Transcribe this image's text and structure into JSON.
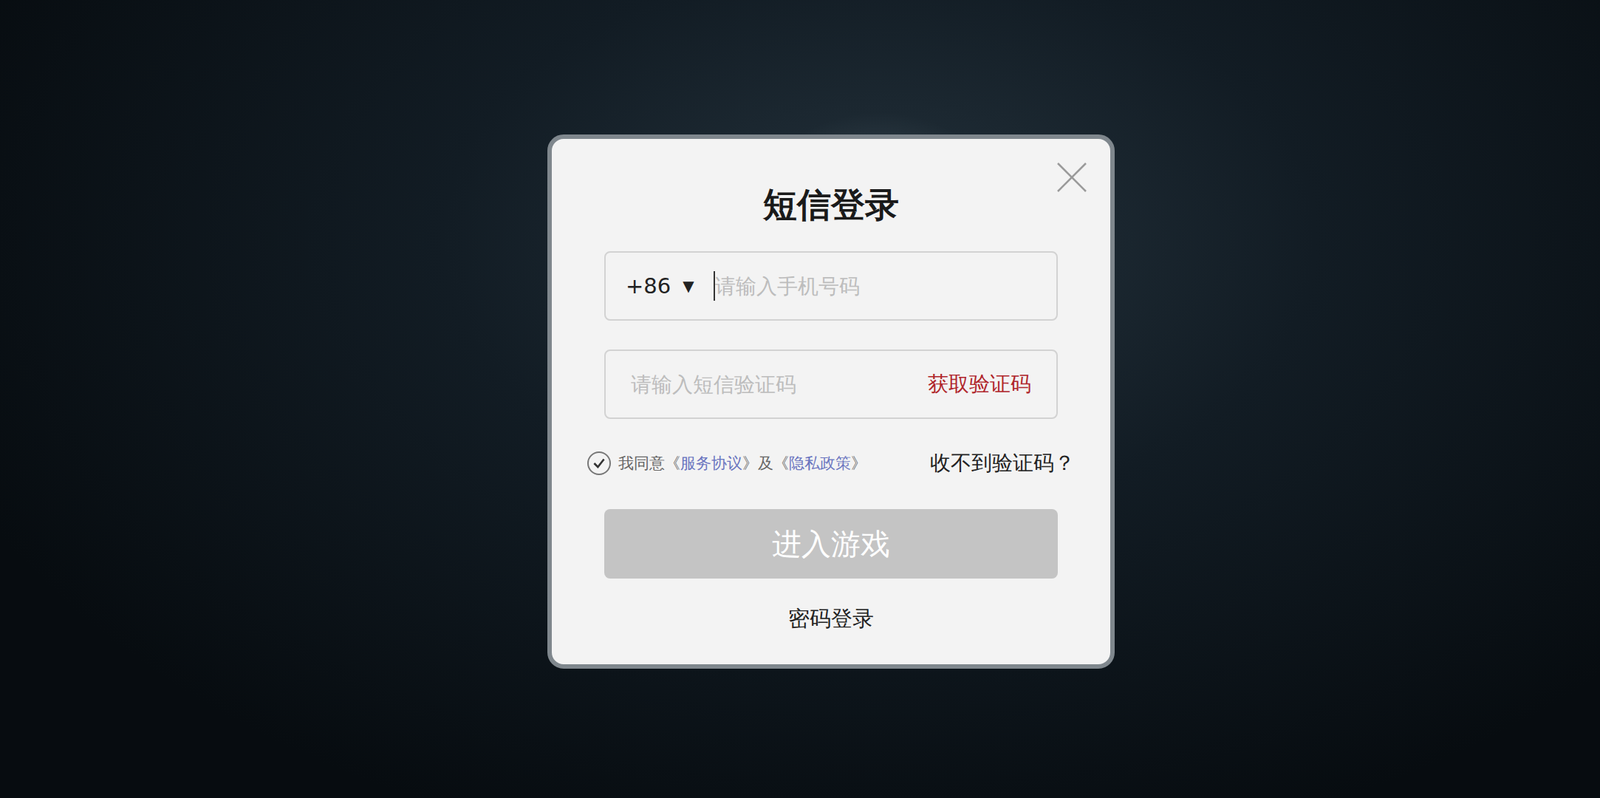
{
  "dialog": {
    "title": "短信登录"
  },
  "phone": {
    "country_code": "+86",
    "dropdown": "▼",
    "placeholder": "请输入手机号码"
  },
  "sms_code": {
    "placeholder": "请输入短信验证码",
    "action": "获取验证码"
  },
  "agreement": {
    "checked": true,
    "prefix": "我同意",
    "open": "《",
    "close": "》",
    "joiner": "及",
    "links": [
      "服务协议",
      "隐私政策"
    ]
  },
  "help_link": "收不到验证码？",
  "submit": {
    "label": "进入游戏",
    "disabled": true
  },
  "alt_login": "密码登录"
}
